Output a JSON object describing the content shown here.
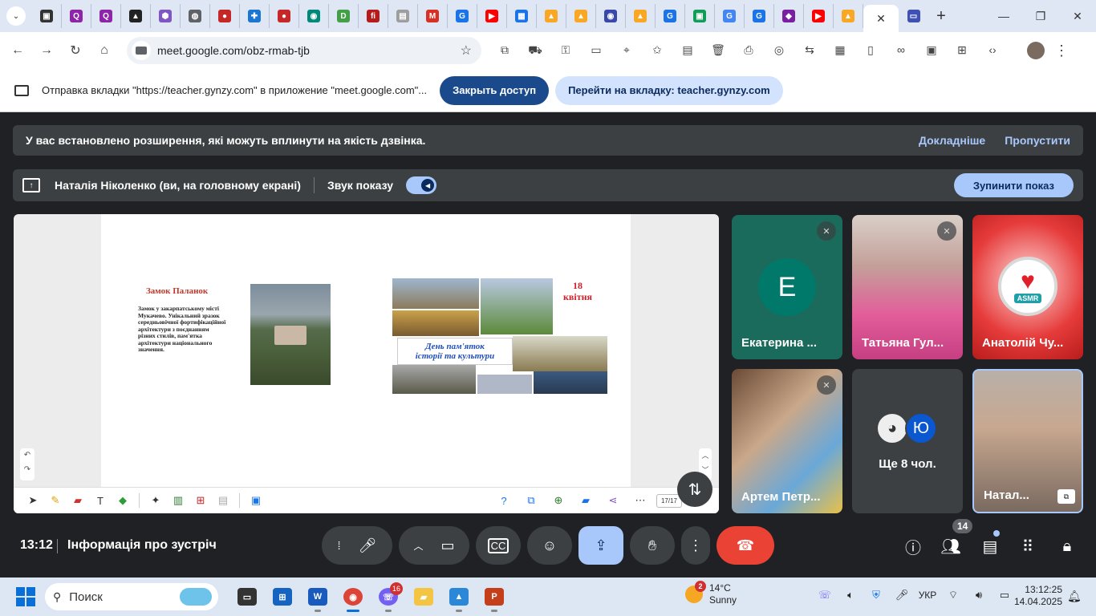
{
  "browser": {
    "tab_icons": [
      {
        "name": "tab-app-icon",
        "color": "#333333",
        "glyph": "▣"
      },
      {
        "name": "tab-q-icon",
        "color": "#8e24aa",
        "glyph": "Q"
      },
      {
        "name": "tab-q-icon",
        "color": "#8e24aa",
        "glyph": "Q"
      },
      {
        "name": "tab-triangle-icon",
        "color": "#222222",
        "glyph": "▲"
      },
      {
        "name": "tab-hex-icon",
        "color": "#7e57c2",
        "glyph": "⬢"
      },
      {
        "name": "tab-globe-icon",
        "color": "#5f6368",
        "glyph": "◍"
      },
      {
        "name": "tab-red-icon",
        "color": "#c62828",
        "glyph": "●"
      },
      {
        "name": "tab-puzzle-icon",
        "color": "#1976d2",
        "glyph": "✚"
      },
      {
        "name": "tab-red-icon",
        "color": "#c62828",
        "glyph": "●"
      },
      {
        "name": "tab-chat-icon",
        "color": "#00897b",
        "glyph": "◉"
      },
      {
        "name": "tab-d-icon",
        "color": "#43a047",
        "glyph": "D"
      },
      {
        "name": "tab-fi-icon",
        "color": "#b71c1c",
        "glyph": "fi"
      },
      {
        "name": "tab-doc-icon",
        "color": "#9e9e9e",
        "glyph": "▤"
      },
      {
        "name": "tab-gmail-icon",
        "color": "#d93025",
        "glyph": "M"
      },
      {
        "name": "tab-g-icon",
        "color": "#1a73e8",
        "glyph": "G"
      },
      {
        "name": "tab-youtube-icon",
        "color": "#ff0000",
        "glyph": "▶"
      },
      {
        "name": "tab-grid-icon",
        "color": "#1a73e8",
        "glyph": "▦"
      },
      {
        "name": "tab-bell-icon",
        "color": "#f9a825",
        "glyph": "▲"
      },
      {
        "name": "tab-bell-icon",
        "color": "#f9a825",
        "glyph": "▲"
      },
      {
        "name": "tab-chat-icon",
        "color": "#3949ab",
        "glyph": "◉"
      },
      {
        "name": "tab-bell-icon",
        "color": "#f9a825",
        "glyph": "▲"
      },
      {
        "name": "tab-g-icon",
        "color": "#1a73e8",
        "glyph": "G"
      },
      {
        "name": "tab-classroom-icon",
        "color": "#0f9d58",
        "glyph": "▣"
      },
      {
        "name": "tab-google-icon",
        "color": "#4285f4",
        "glyph": "G"
      },
      {
        "name": "tab-g-icon",
        "color": "#1a73e8",
        "glyph": "G"
      },
      {
        "name": "tab-canva-icon",
        "color": "#7b1fa2",
        "glyph": "◆"
      },
      {
        "name": "tab-youtube-icon",
        "color": "#ff0000",
        "glyph": "▶"
      },
      {
        "name": "tab-bell-icon",
        "color": "#f9a825",
        "glyph": "▲"
      }
    ],
    "url": "meet.google.com/obz-rmab-tjb"
  },
  "sharebar": {
    "text": "Отправка вкладки \"https://teacher.gynzy.com\" в приложение \"meet.google.com\"...",
    "stop_label": "Закрыть доступ",
    "goto_label": "Перейти на вкладку: teacher.gynzy.com"
  },
  "notice": {
    "message": "У вас встановлено розширення, які можуть вплинути на якість дзвінка.",
    "learn_more": "Докладніше",
    "skip": "Пропустити"
  },
  "presenting": {
    "label": "Наталія Ніколенко (ви, на головному екрані)",
    "sound_label": "Звук показу",
    "stop_label": "Зупинити показ"
  },
  "slide": {
    "title": "Замок Паланок",
    "body": "Замок у закарпатському місті Мукачево. Унікальний зразок середньовічної фортифікаційної архітектури з поєднанням різних стилів, пам'ятка архітектури національного значення.",
    "badge_line1": "День пам'яток",
    "badge_line2": "історії та культури",
    "date_line1": "18",
    "date_line2": "квітня",
    "page": "17/17"
  },
  "participants": [
    {
      "name": "Екатерина ...",
      "initial": "Е",
      "color": "#00796b"
    },
    {
      "name": "Татьяна Гул..."
    },
    {
      "name": "Анатолій Чу..."
    },
    {
      "name": "Артем Петр..."
    },
    {
      "more_label": "Ще 8 чол.",
      "initial": "Ю",
      "color": "#0b57d0"
    },
    {
      "name": "Натал..."
    }
  ],
  "meeting": {
    "time": "13:12",
    "info": "Інформація про зустріч",
    "people_count": "14"
  },
  "taskbar": {
    "search": "Поиск",
    "teams_badge": "16",
    "weather_badge": "2",
    "temp": "14°C",
    "condition": "Sunny",
    "lang": "УКР",
    "time": "13:12:25",
    "date": "14.04.2025"
  }
}
